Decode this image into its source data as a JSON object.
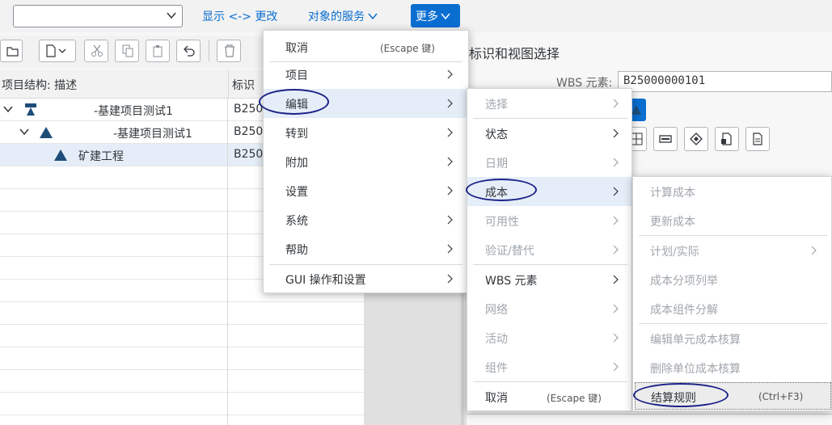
{
  "topbar": {
    "dropdown_value": "",
    "link_display_change": "显示 <-> 更改",
    "link_object_services": "对象的服务",
    "more_button": "更多"
  },
  "tree": {
    "col_structure": "项目结构: 描述",
    "col_id": "标识",
    "rows": [
      {
        "desc": "-基建项目测试1",
        "id": "B250"
      },
      {
        "desc": "-基建项目测试1",
        "id": "B250"
      },
      {
        "desc": "矿建工程",
        "id": "B250"
      }
    ]
  },
  "detail": {
    "title": "标识和视图选择",
    "wbs_label": "WBS 元素:",
    "wbs_value": "B25000000101"
  },
  "menu1": {
    "items": [
      {
        "label": "取消",
        "shortcut": "(Escape 键)"
      },
      {
        "label": "项目"
      },
      {
        "label": "编辑"
      },
      {
        "label": "转到"
      },
      {
        "label": "附加"
      },
      {
        "label": "设置"
      },
      {
        "label": "系统"
      },
      {
        "label": "帮助"
      },
      {
        "label": "GUI 操作和设置"
      }
    ]
  },
  "menu2": {
    "items": [
      {
        "label": "选择"
      },
      {
        "label": "状态"
      },
      {
        "label": "日期"
      },
      {
        "label": "成本"
      },
      {
        "label": "可用性"
      },
      {
        "label": "验证/替代"
      },
      {
        "label": "WBS 元素"
      },
      {
        "label": "网络"
      },
      {
        "label": "活动"
      },
      {
        "label": "组件"
      },
      {
        "label": "取消",
        "shortcut": "(Escape 键)"
      }
    ]
  },
  "menu3": {
    "items": [
      {
        "label": "计算成本"
      },
      {
        "label": "更新成本"
      },
      {
        "label": "计划/实际"
      },
      {
        "label": "成本分项列举"
      },
      {
        "label": "成本组件分解"
      },
      {
        "label": "编辑单元成本核算"
      },
      {
        "label": "删除单位成本核算"
      },
      {
        "label": "结算规则",
        "shortcut": "(Ctrl+F3)"
      }
    ]
  },
  "colors": {
    "accent": "#0a6ed1",
    "highlight": "#e5eef8",
    "annotation_oval": "#1a2187"
  }
}
